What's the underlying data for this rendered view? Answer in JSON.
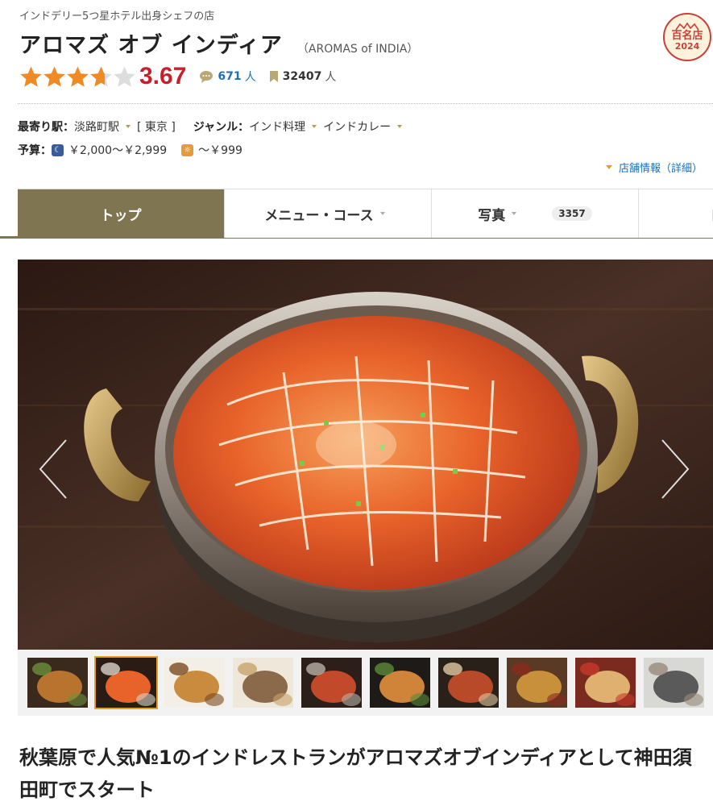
{
  "header": {
    "catchphrase": "インドデリー5つ星ホテル出身シェフの店",
    "name": "アロマズ オブ インディア",
    "name_en": "（AROMAS of INDIA）",
    "award": {
      "label": "百名店",
      "year": "2024"
    }
  },
  "rating": {
    "score": "3.67",
    "stars_value": 3.67,
    "reviews_count": "671",
    "reviews_unit": "人",
    "saves_count": "32407",
    "saves_unit": "人"
  },
  "info": {
    "station_label": "最寄り駅：",
    "station": "淡路町駅",
    "area": "[ 東京 ]",
    "genre_label": "ジャンル：",
    "genre1": "インド料理",
    "genre2": "インドカレー",
    "budget_label": "予算：",
    "budget_dinner": "￥2,000～￥2,999",
    "budget_lunch": "～￥999",
    "detail_link": "店舗情報（詳細）"
  },
  "tabs": [
    {
      "label": "トップ"
    },
    {
      "label": "メニュー・コース"
    },
    {
      "label": "写真",
      "count": "3357"
    },
    {
      "label": "口"
    }
  ],
  "gallery": {
    "thumbnail_count": 10,
    "selected_index": 1
  },
  "headline": "秋葉原で人気№1のインドレストランがアロマズオブインディアとして神田須田町でスタート",
  "colors": {
    "accent": "#7f7550",
    "score": "#c8202b",
    "star": "#f08a24",
    "link": "#1d6fb8"
  }
}
